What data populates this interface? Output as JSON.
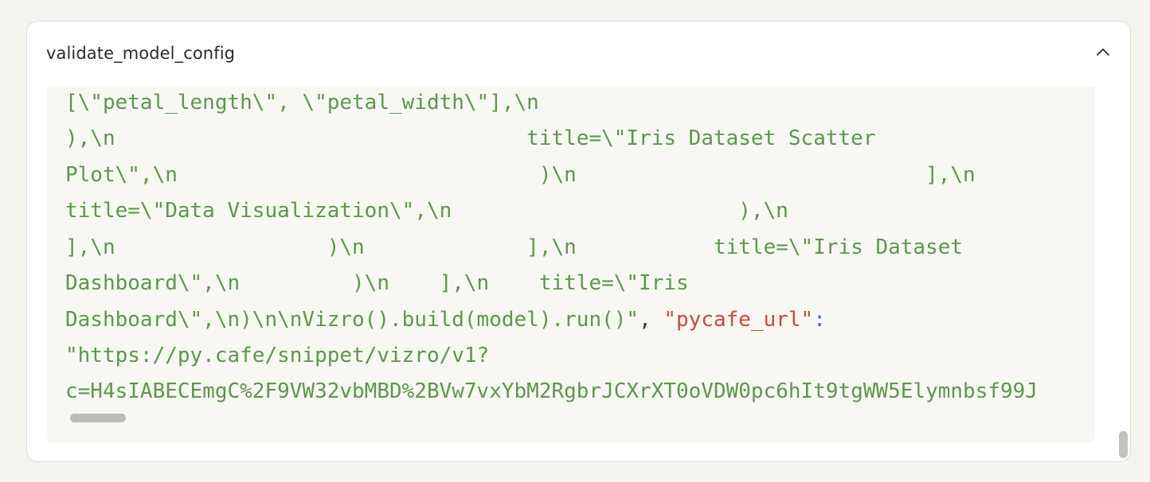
{
  "panel": {
    "title": "validate_model_config",
    "collapse_icon": "chevron-up-icon"
  },
  "code": {
    "line1": "[\\\"petal_length\\\", \\\"petal_width\\\"],\\n",
    "line2": "),\\n                                 title=\\\"Iris Dataset Scatter",
    "line3": "Plot\\\",\\n                             )\\n                            ],\\n",
    "line4": "title=\\\"Data Visualization\\\",\\n                       ),\\n",
    "line5": "],\\n                 )\\n             ],\\n           title=\\\"Iris Dataset",
    "line6": "Dashboard\\\",\\n         )\\n    ],\\n    title=\\\"Iris",
    "line7_string": "Dashboard\\\",\\n)\\n\\nVizro().build(model).run()\"",
    "line7_comma": ", ",
    "line7_key": "\"pycafe_url\"",
    "line7_colon": ":",
    "line8": "\"https://py.cafe/snippet/vizro/v1?",
    "line9": "c=H4sIABECEmgC%2F9VW32vbMBD%2BVw7vxYbM2RgbrJCXrXT0oVDW0pc6hIt9tgWW5Elymnbsf99J"
  },
  "colors": {
    "string": "#5a9a47",
    "key": "#cc4a3a",
    "colon": "#3870c8",
    "background": "#f8f7f4"
  }
}
